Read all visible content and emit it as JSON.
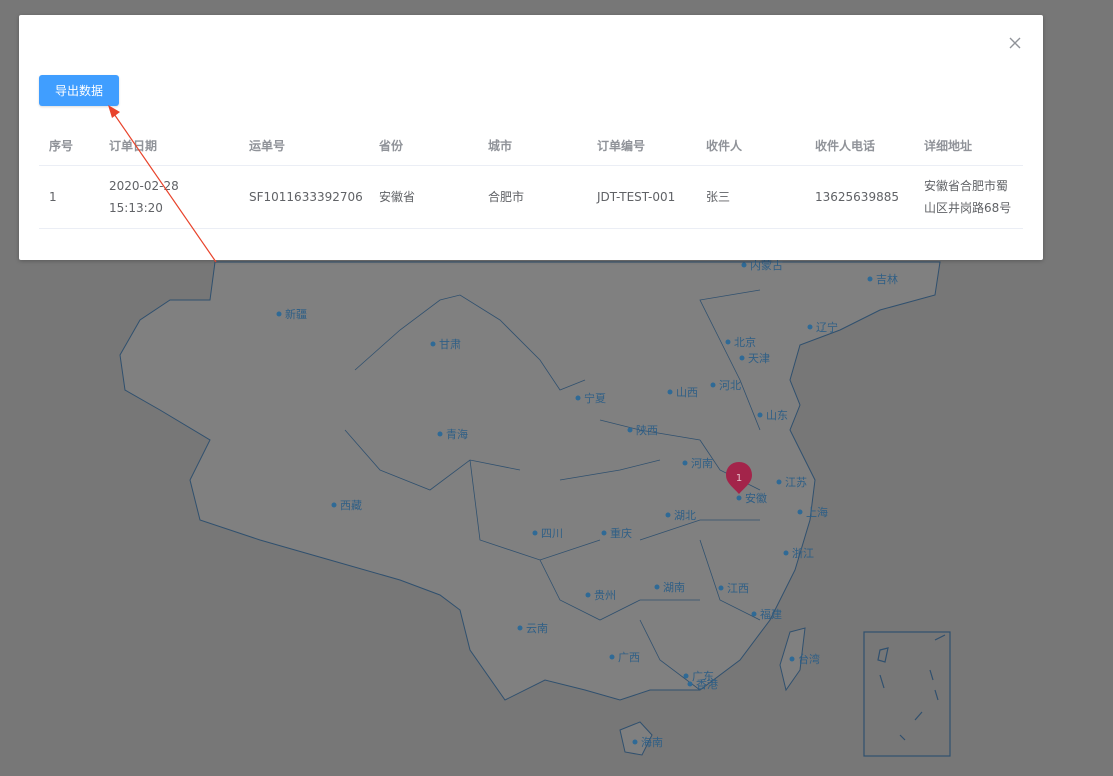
{
  "dialog": {
    "export_label": "导出数据",
    "close_icon": "close-icon"
  },
  "table": {
    "columns": [
      "序号",
      "订单日期",
      "运单号",
      "省份",
      "城市",
      "订单编号",
      "收件人",
      "收件人电话",
      "详细地址"
    ],
    "rows": [
      {
        "index": "1",
        "order_date": "2020-02-28 15:13:20",
        "waybill": "SF1011633392706",
        "province": "安徽省",
        "city": "合肥市",
        "order_no": "JDT-TEST-001",
        "recipient": "张三",
        "phone": "13625639885",
        "address": "安徽省合肥市蜀山区井岗路68号"
      }
    ]
  },
  "map": {
    "provinces": [
      "内蒙古",
      "吉林",
      "新疆",
      "辽宁",
      "甘肃",
      "北京",
      "天津",
      "宁夏",
      "山西",
      "河北",
      "山东",
      "青海",
      "陕西",
      "河南",
      "江苏",
      "安徽",
      "西藏",
      "湖北",
      "上海",
      "四川",
      "重庆",
      "浙江",
      "湖南",
      "江西",
      "贵州",
      "福建",
      "云南",
      "广西",
      "台湾",
      "广东",
      "香港",
      "海南"
    ],
    "marker_value": "1",
    "marker_color": "#a3244a"
  },
  "colors": {
    "overlay": "#777777",
    "button": "#409eff",
    "arrow": "#e8432b"
  }
}
